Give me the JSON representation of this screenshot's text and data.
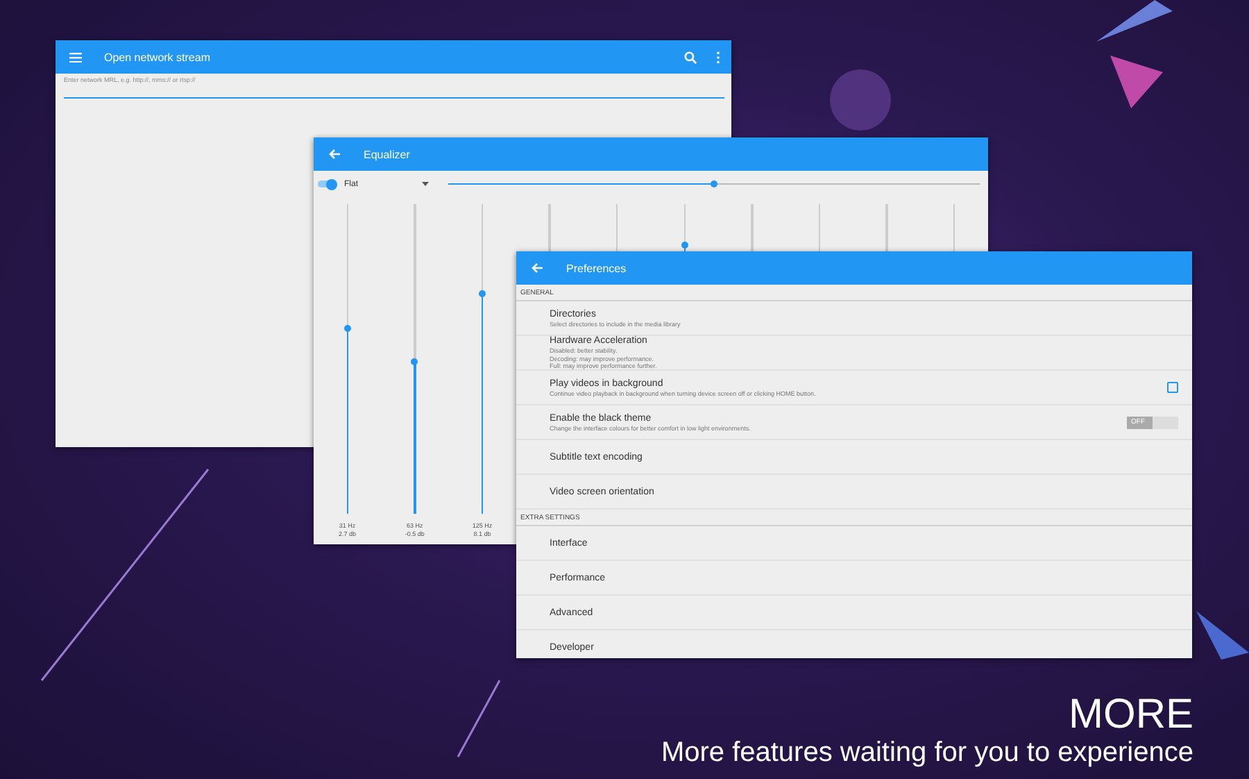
{
  "network_window": {
    "title": "Open network stream",
    "field": {
      "hint": "Enter network MRL, e.g. http://, mms:// or rtsp://"
    }
  },
  "equalizer_window": {
    "title": "Equalizer",
    "enabled": true,
    "preset": "Flat",
    "preamp": {
      "level": 0.5
    },
    "bands": [
      {
        "level": 0.6,
        "frequency": "31 Hz",
        "gain": "2.7 db"
      },
      {
        "level": 0.49,
        "frequency": "63 Hz",
        "gain": "-0.5 db"
      },
      {
        "level": 0.71,
        "frequency": "125 Hz",
        "gain": "8.1 db"
      },
      {
        "kind": "covered"
      },
      {
        "kind": "covered"
      },
      {
        "kind": "slider",
        "level": 0.87
      },
      {
        "kind": "covered"
      },
      {
        "kind": "covered"
      },
      {
        "kind": "covered"
      },
      {
        "kind": "covered"
      }
    ]
  },
  "preferences_window": {
    "title": "Preferences",
    "sections": [
      {
        "header": "GENERAL",
        "items": [
          {
            "kind": "link",
            "title": "Directories",
            "subtitle": [
              "Select directories to include in the media library"
            ]
          },
          {
            "kind": "link",
            "title": "Hardware Acceleration",
            "subtitle": [
              "Disabled: better stability.",
              "Decoding: may improve performance.",
              "Full: may improve performance further."
            ]
          },
          {
            "kind": "checkbox",
            "title": "Play videos in background",
            "subtitle": [
              "Continue video playback in background when turning device screen off or clicking HOME button."
            ],
            "checked": false
          },
          {
            "kind": "toggle",
            "title": "Enable the black theme",
            "subtitle": [
              "Change the interface colours for better comfort in low light environments."
            ],
            "on": false,
            "label": "OFF"
          },
          {
            "kind": "link",
            "title": "Subtitle text encoding"
          },
          {
            "kind": "link",
            "title": "Video screen orientation"
          }
        ]
      },
      {
        "header": "EXTRA SETTINGS",
        "items": [
          {
            "kind": "link",
            "title": "Interface"
          },
          {
            "kind": "link",
            "title": "Performance"
          },
          {
            "kind": "link",
            "title": "Advanced"
          },
          {
            "kind": "link",
            "title": "Developer"
          }
        ]
      }
    ]
  },
  "promo": {
    "headline": "MORE",
    "tagline": "More features waiting for you to experience"
  }
}
